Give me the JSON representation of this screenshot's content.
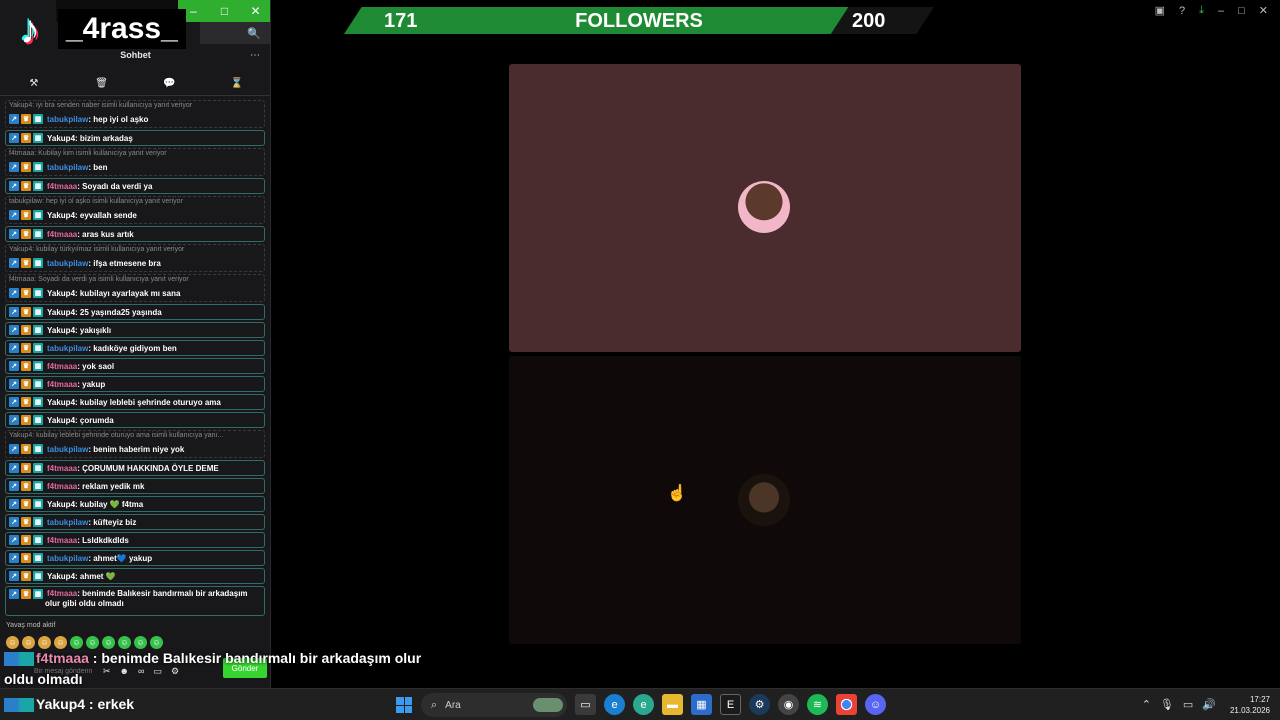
{
  "chat": {
    "username": "_4rass_",
    "title": "Sohbet",
    "more_icon": "⋯",
    "search_icon": "🔍",
    "toolbar": [
      "hammer-icon",
      "trash-icon",
      "chat-bubble-icon",
      "hourglass-icon"
    ],
    "items": [
      {
        "reply": "Yakup4: iyi bra senden naber isimli kullanıcıya yanıt veriyor",
        "user": "tabukpilaw",
        "color": "#3b8fe0",
        "text": "hep iyi ol aşko"
      },
      {
        "user": "Yakup4",
        "color": "#ffffff",
        "text": "bizim arkadaş"
      },
      {
        "reply": "f4tmaaa: Kubilay kim isimli kullanıcıya yanıt veriyor",
        "user": "tabukpilaw",
        "color": "#3b8fe0",
        "text": "ben"
      },
      {
        "user": "f4tmaaa",
        "color": "#e06aa0",
        "text": "Soyadı da verdi ya"
      },
      {
        "reply": "tabukpilaw: hep iyi ol aşko isimli kullanıcıya yanıt veriyor",
        "user": "Yakup4",
        "color": "#ffffff",
        "text": "eyvallah sende"
      },
      {
        "user": "f4tmaaa",
        "color": "#e06aa0",
        "text": "aras kus artık"
      },
      {
        "reply": "Yakup4: kubilay türkyılmaz isimli kullanıcıya yanıt veriyor",
        "user": "tabukpilaw",
        "color": "#3b8fe0",
        "text": "ifşa etmesene bra"
      },
      {
        "reply": "f4tmaaa: Soyadı da verdi ya isimli kullanıcıya yanıt veriyor",
        "user": "Yakup4",
        "color": "#ffffff",
        "text": "kubilayı ayarlayak mı sana"
      },
      {
        "user": "Yakup4",
        "color": "#ffffff",
        "text": "25 yaşında25 yaşında"
      },
      {
        "user": "Yakup4",
        "color": "#ffffff",
        "text": "yakışıklı"
      },
      {
        "user": "tabukpilaw",
        "color": "#3b8fe0",
        "text": "kadıköye gidiyom ben"
      },
      {
        "user": "f4tmaaa",
        "color": "#e06aa0",
        "text": "yok saol"
      },
      {
        "user": "f4tmaaa",
        "color": "#e06aa0",
        "text": "yakup"
      },
      {
        "user": "Yakup4",
        "color": "#ffffff",
        "text": "kubilay leblebi şehrinde oturuyo ama"
      },
      {
        "user": "Yakup4",
        "color": "#ffffff",
        "text": "çorumda"
      },
      {
        "reply": "Yakup4: kubilay leblebi şehrinde oturuyo ama isimli kullanıcıya yanı...",
        "user": "tabukpilaw",
        "color": "#3b8fe0",
        "text": "benim haberim niye yok"
      },
      {
        "user": "f4tmaaa",
        "color": "#e06aa0",
        "text": "ÇORUMUM HAKKINDA ÖYLE DEME"
      },
      {
        "user": "f4tmaaa",
        "color": "#e06aa0",
        "text": "reklam yedik mk"
      },
      {
        "user": "Yakup4",
        "color": "#ffffff",
        "text": "kubilay 💚 f4tma"
      },
      {
        "user": "tabukpilaw",
        "color": "#3b8fe0",
        "text": "küfteyiz biz"
      },
      {
        "user": "f4tmaaa",
        "color": "#e06aa0",
        "text": "Lsldkdkdlds"
      },
      {
        "user": "tabukpilaw",
        "color": "#3b8fe0",
        "text": "ahmet💙 yakup"
      },
      {
        "user": "Yakup4",
        "color": "#ffffff",
        "text": "ahmet 💚"
      },
      {
        "user": "f4tmaaa",
        "color": "#e06aa0",
        "text": "benimde Balıkesir bandırmalı bir arkadaşım olur gibi oldu olmadı",
        "tall": true
      },
      {
        "user": "Yakup4",
        "color": "#ffffff",
        "text": "erkek"
      }
    ],
    "slow_mode": "Yavaş mod aktif",
    "input_placeholder": "Bir mesaj gönderin",
    "send_label": "Gönder"
  },
  "followers": {
    "current": "171",
    "label": "FOLLOWERS",
    "goal": "200",
    "progress": 0.855,
    "fill_color": "#1e8a33"
  },
  "caption": {
    "user": "f4tmaaa",
    "text": " : benimde Balıkesir bandırmalı bir arkadaşım olur oldu olmadı"
  },
  "ticker": {
    "text": "Yakup4 : erkek"
  },
  "taskbar": {
    "search_placeholder": "Ara",
    "time": "17:27",
    "date": "21.03.2026"
  }
}
